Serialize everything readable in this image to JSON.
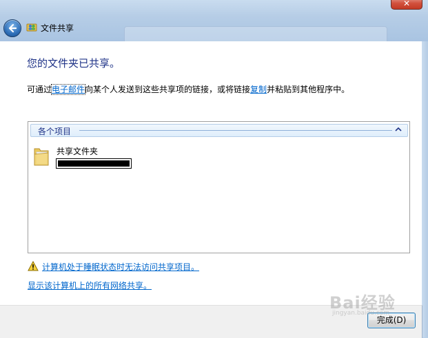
{
  "window": {
    "title": "文件共享",
    "close_symbol": "✕"
  },
  "content": {
    "heading": "您的文件夹已共享。",
    "desc_prefix": "可通过",
    "desc_email_link": "电子邮件",
    "desc_middle": "向某个人发送到这些共享项的链接，或将链接",
    "desc_copy_link": "复制",
    "desc_suffix": "并粘贴到其他程序中。"
  },
  "items_panel": {
    "header": "各个项目",
    "items": [
      {
        "name": "共享文件夹",
        "icon": "folder-icon"
      }
    ]
  },
  "links": {
    "sleep_warning": "计算机处于睡眠状态时无法访问共享项目。",
    "show_all_shares": "显示该计算机上的所有网络共享。"
  },
  "footer": {
    "finish_button": "完成(D)"
  },
  "watermark": {
    "main": "Bai经验",
    "sub": "jingyan.baidu.com"
  },
  "colors": {
    "heading": "#1e3287",
    "link": "#0066cc",
    "frame": "#b9d1ea",
    "footer": "#f0f0f0"
  }
}
